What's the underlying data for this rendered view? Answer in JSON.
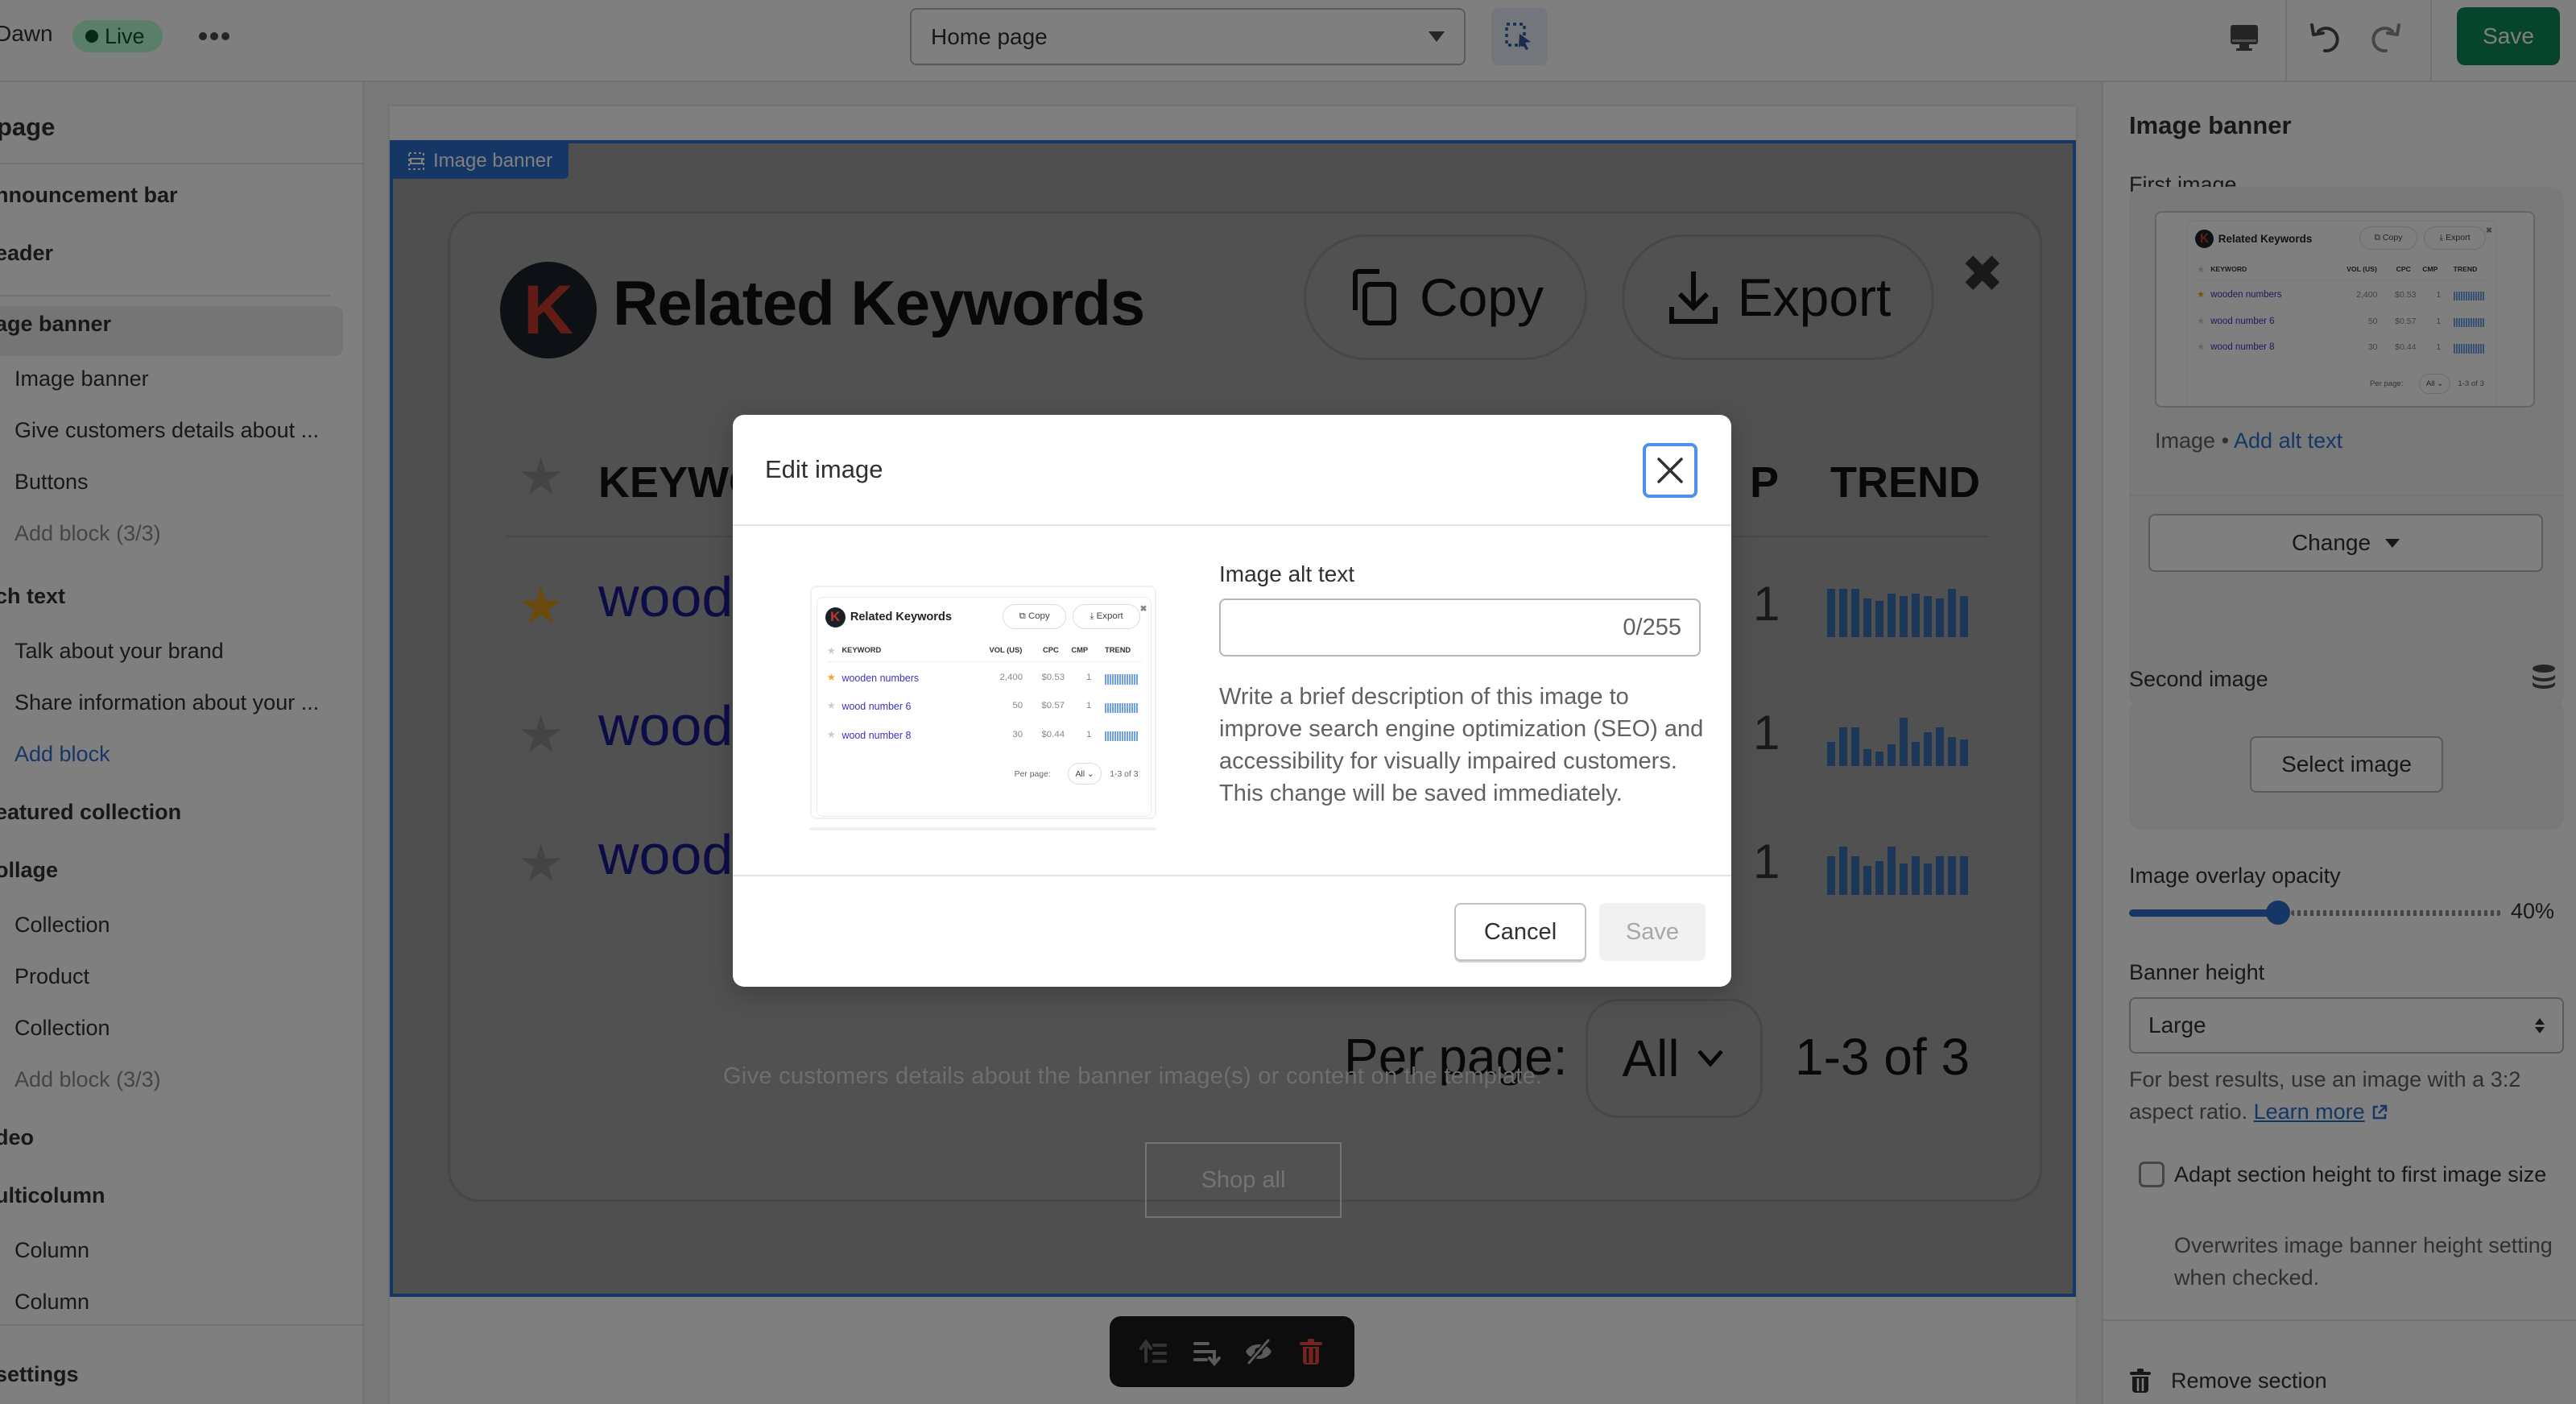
{
  "topbar": {
    "theme_name": "Dawn",
    "live_badge": "Live",
    "page_selector": "Home page",
    "save_label": "Save",
    "icons": [
      "more-icon",
      "inspector-icon",
      "desktop-icon",
      "undo-icon",
      "redo-icon"
    ]
  },
  "sidebar": {
    "title": "page",
    "items": [
      {
        "label": "nnouncement bar",
        "kind": "section"
      },
      {
        "label": "eader",
        "kind": "section"
      },
      {
        "label": "age banner",
        "kind": "section",
        "selected": true
      },
      {
        "label": "Image banner",
        "kind": "block"
      },
      {
        "label": "Give customers details about ...",
        "kind": "block"
      },
      {
        "label": "Buttons",
        "kind": "block"
      },
      {
        "label": "Add block (3/3)",
        "kind": "block-disabled"
      },
      {
        "label": "ch text",
        "kind": "section"
      },
      {
        "label": "Talk about your brand",
        "kind": "block"
      },
      {
        "label": "Share information about your ...",
        "kind": "block"
      },
      {
        "label": "Add block",
        "kind": "add-link"
      },
      {
        "label": "eatured collection",
        "kind": "section"
      },
      {
        "label": "ollage",
        "kind": "section"
      },
      {
        "label": "Collection",
        "kind": "block"
      },
      {
        "label": "Product",
        "kind": "block"
      },
      {
        "label": "Collection",
        "kind": "block"
      },
      {
        "label": "Add block (3/3)",
        "kind": "block-disabled"
      },
      {
        "label": "deo",
        "kind": "section"
      },
      {
        "label": "ulticolumn",
        "kind": "section"
      },
      {
        "label": "Column",
        "kind": "block"
      },
      {
        "label": "Column",
        "kind": "block"
      }
    ],
    "footer": "settings"
  },
  "canvas": {
    "banner_tag": "Image banner",
    "banner_image": {
      "logo_letter": "K",
      "title": "Related Keywords",
      "copy_label": "Copy",
      "export_label": "Export",
      "close_glyph": "✖",
      "headers": {
        "keyword": "KEYWO",
        "trend": "TREND",
        "cmp_partial": "P"
      },
      "rows": [
        {
          "keyword": "wood",
          "starred": true,
          "cmp": "1"
        },
        {
          "keyword": "wood",
          "starred": false,
          "cmp": "1"
        },
        {
          "keyword": "wood",
          "starred": false,
          "cmp": "1"
        }
      ],
      "per_page_label": "Per page:",
      "per_page_value": "All",
      "count": "1-3 of 3"
    },
    "caption": "Give customers details about the banner image(s) or content on the template.",
    "shop_all": "Shop all",
    "section_toolbar": [
      "move-up-icon",
      "move-down-icon",
      "hide-icon",
      "delete-icon"
    ]
  },
  "thumbnail": {
    "logo_letter": "K",
    "title": "Related Keywords",
    "copy_label": "Copy",
    "export_label": "Export",
    "headers": [
      "KEYWORD",
      "VOL (US)",
      "CPC",
      "CMP",
      "TREND"
    ],
    "rows": [
      {
        "keyword": "wooden numbers",
        "vol": "2,400",
        "cpc": "$0.53",
        "cmp": "1",
        "starred": true
      },
      {
        "keyword": "wood number 6",
        "vol": "50",
        "cpc": "$0.57",
        "cmp": "1",
        "starred": false
      },
      {
        "keyword": "wood number 8",
        "vol": "30",
        "cpc": "$0.44",
        "cmp": "1",
        "starred": false
      }
    ],
    "per_page_label": "Per page:",
    "per_page_value": "All",
    "count": "1-3 of 3"
  },
  "rpanel": {
    "title": "Image banner",
    "first_image_label": "First image",
    "image_meta": "Image",
    "add_alt_text": "Add alt text",
    "change_label": "Change",
    "second_image_label": "Second image",
    "select_image_label": "Select image",
    "overlay_label": "Image overlay opacity",
    "overlay_value": 40,
    "overlay_value_text": "40%",
    "banner_height_label": "Banner height",
    "banner_height_value": "Large",
    "help_text": "For best results, use an image with a 3:2 aspect ratio.",
    "learn_more": "Learn more",
    "adapt_label": "Adapt section height to first image size",
    "adapt_checked": false,
    "adapt_help": "Overwrites image banner height setting when checked.",
    "remove_section": "Remove section"
  },
  "modal": {
    "title": "Edit image",
    "alt_label": "Image alt text",
    "alt_value": "",
    "alt_counter": "0/255",
    "help": "Write a brief description of this image to improve search engine optimization (SEO) and accessibility for visually impaired customers. This change will be saved immediately.",
    "cancel_label": "Cancel",
    "save_label": "Save"
  },
  "colors": {
    "accent": "#2c6ecb",
    "primary_save": "#0d8a56",
    "live_badge_bg": "#b4fed2",
    "danger": "#e51c00",
    "focus_ring": "#4e8ff0"
  }
}
